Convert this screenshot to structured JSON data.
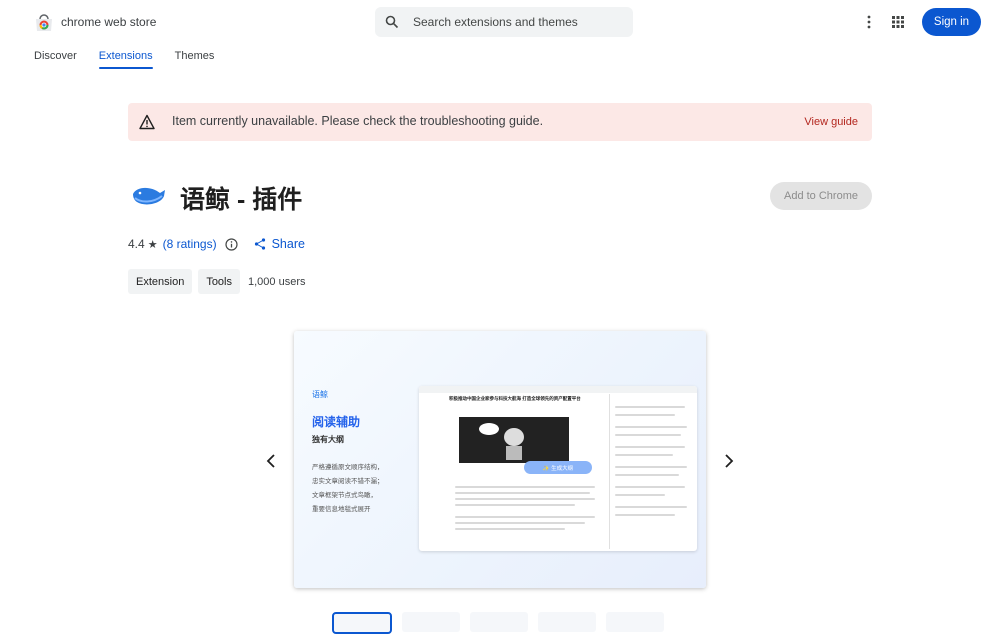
{
  "header": {
    "brand": "chrome web store",
    "search_placeholder": "Search extensions and themes",
    "signin_label": "Sign in"
  },
  "nav": {
    "tabs": [
      {
        "label": "Discover",
        "active": false
      },
      {
        "label": "Extensions",
        "active": true
      },
      {
        "label": "Themes",
        "active": false
      }
    ]
  },
  "banner": {
    "text": "Item currently unavailable. Please check the troubleshooting guide.",
    "link": "View guide"
  },
  "extension": {
    "title": "语鲸 - 插件",
    "add_button": "Add to Chrome",
    "rating": "4.4",
    "star": "★",
    "ratings_link": "8 ratings",
    "share_label": "Share",
    "chips": [
      "Extension",
      "Tools"
    ],
    "users": "1,000 users"
  },
  "slide": {
    "logo_text": "语鲸",
    "heading": "阅读辅助",
    "subheading": "独有大纲",
    "lines": [
      "严格遵循原文顺序结构，",
      "忠实文章阅读不错不漏；",
      "文章框架节点式鸟瞰，",
      "重要信息地毯式展开"
    ],
    "screenshot_title": "积极推动中国企业家参与科技大航海 打造全球领先的资产配置平台",
    "button_text": "✨ 生成大纲"
  },
  "colors": {
    "accent": "#0b57d0",
    "banner_bg": "#fce8e6",
    "warning": "#b3261e"
  }
}
